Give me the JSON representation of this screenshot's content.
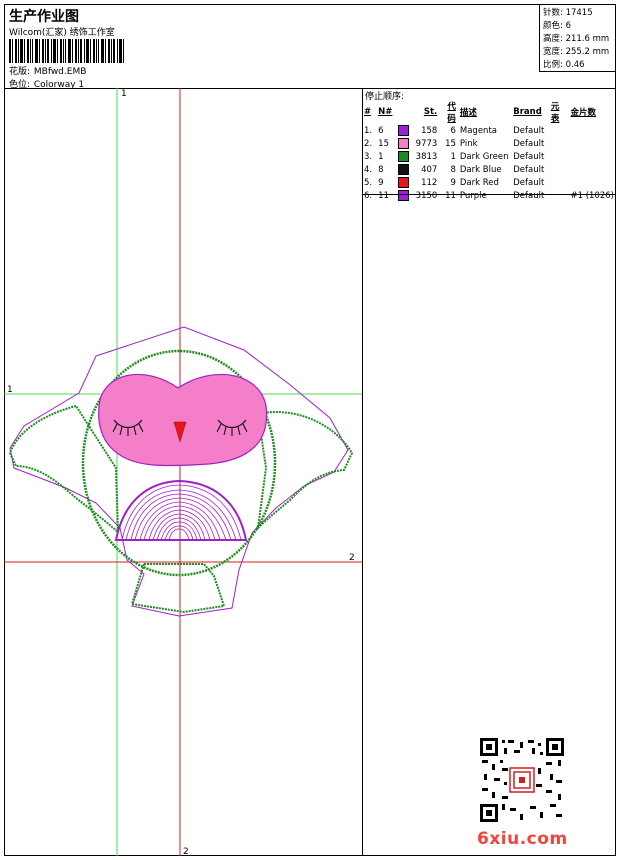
{
  "header": {
    "title": "生产作业图",
    "company": "Wilcom(汇家) 绣饰工作室",
    "file_label": "花版:",
    "file_value": "MBfwd.EMB",
    "colorway_label": "色位:",
    "colorway_value": "Colorway 1"
  },
  "specs": {
    "stitches_label": "针数:",
    "stitches": "17415",
    "colors_label": "颜色:",
    "colors": "6",
    "height_label": "高度:",
    "height": "211.6 mm",
    "width_label": "宽度:",
    "width": "255.2 mm",
    "scale_label": "比例:",
    "scale": "0.46"
  },
  "guides": {
    "v1": "1",
    "h1": "1",
    "v2": "2",
    "h2": "2"
  },
  "stop_sequence": {
    "title": "停止顺序:",
    "headers": [
      "#",
      "N#",
      "St.",
      "代码",
      "描述",
      "Brand",
      "元表",
      "金片数"
    ],
    "rows": [
      {
        "num": "1.",
        "n": "6",
        "color": "#9b1fd6",
        "st": "158",
        "code": "6",
        "desc": "Magenta",
        "brand": "Default",
        "extra": ""
      },
      {
        "num": "2.",
        "n": "15",
        "color": "#f47ec8",
        "st": "9773",
        "code": "15",
        "desc": "Pink",
        "brand": "Default",
        "extra": ""
      },
      {
        "num": "3.",
        "n": "1",
        "color": "#1e8c1e",
        "st": "3813",
        "code": "1",
        "desc": "Dark Green",
        "brand": "Default",
        "extra": ""
      },
      {
        "num": "4.",
        "n": "8",
        "color": "#111111",
        "st": "407",
        "code": "8",
        "desc": "Dark Blue",
        "brand": "Default",
        "extra": ""
      },
      {
        "num": "5.",
        "n": "9",
        "color": "#e8151b",
        "st": "112",
        "code": "9",
        "desc": "Dark Red",
        "brand": "Default",
        "extra": ""
      },
      {
        "num": "6.",
        "n": "11",
        "color": "#9b1fd6",
        "st": "3150",
        "code": "11",
        "desc": "Purple",
        "brand": "Default",
        "extra": "#1 (1026)"
      }
    ]
  },
  "watermark": "6xiu.com",
  "colors": {
    "green": "#1e8c1e",
    "magenta": "#a01fc8",
    "pink": "#f47ec8",
    "red": "#e8151b",
    "guide_green": "#4cd94c",
    "guide_red": "#d02020"
  }
}
